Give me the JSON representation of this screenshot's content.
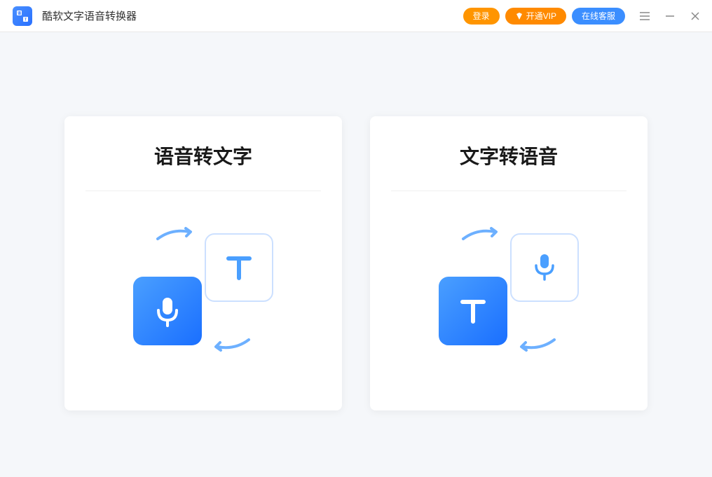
{
  "app": {
    "title": "酷软文字语音转换器"
  },
  "header": {
    "login_label": "登录",
    "vip_label": "开通VIP",
    "service_label": "在线客服"
  },
  "cards": {
    "speech_to_text": {
      "title": "语音转文字"
    },
    "text_to_speech": {
      "title": "文字转语音"
    }
  }
}
